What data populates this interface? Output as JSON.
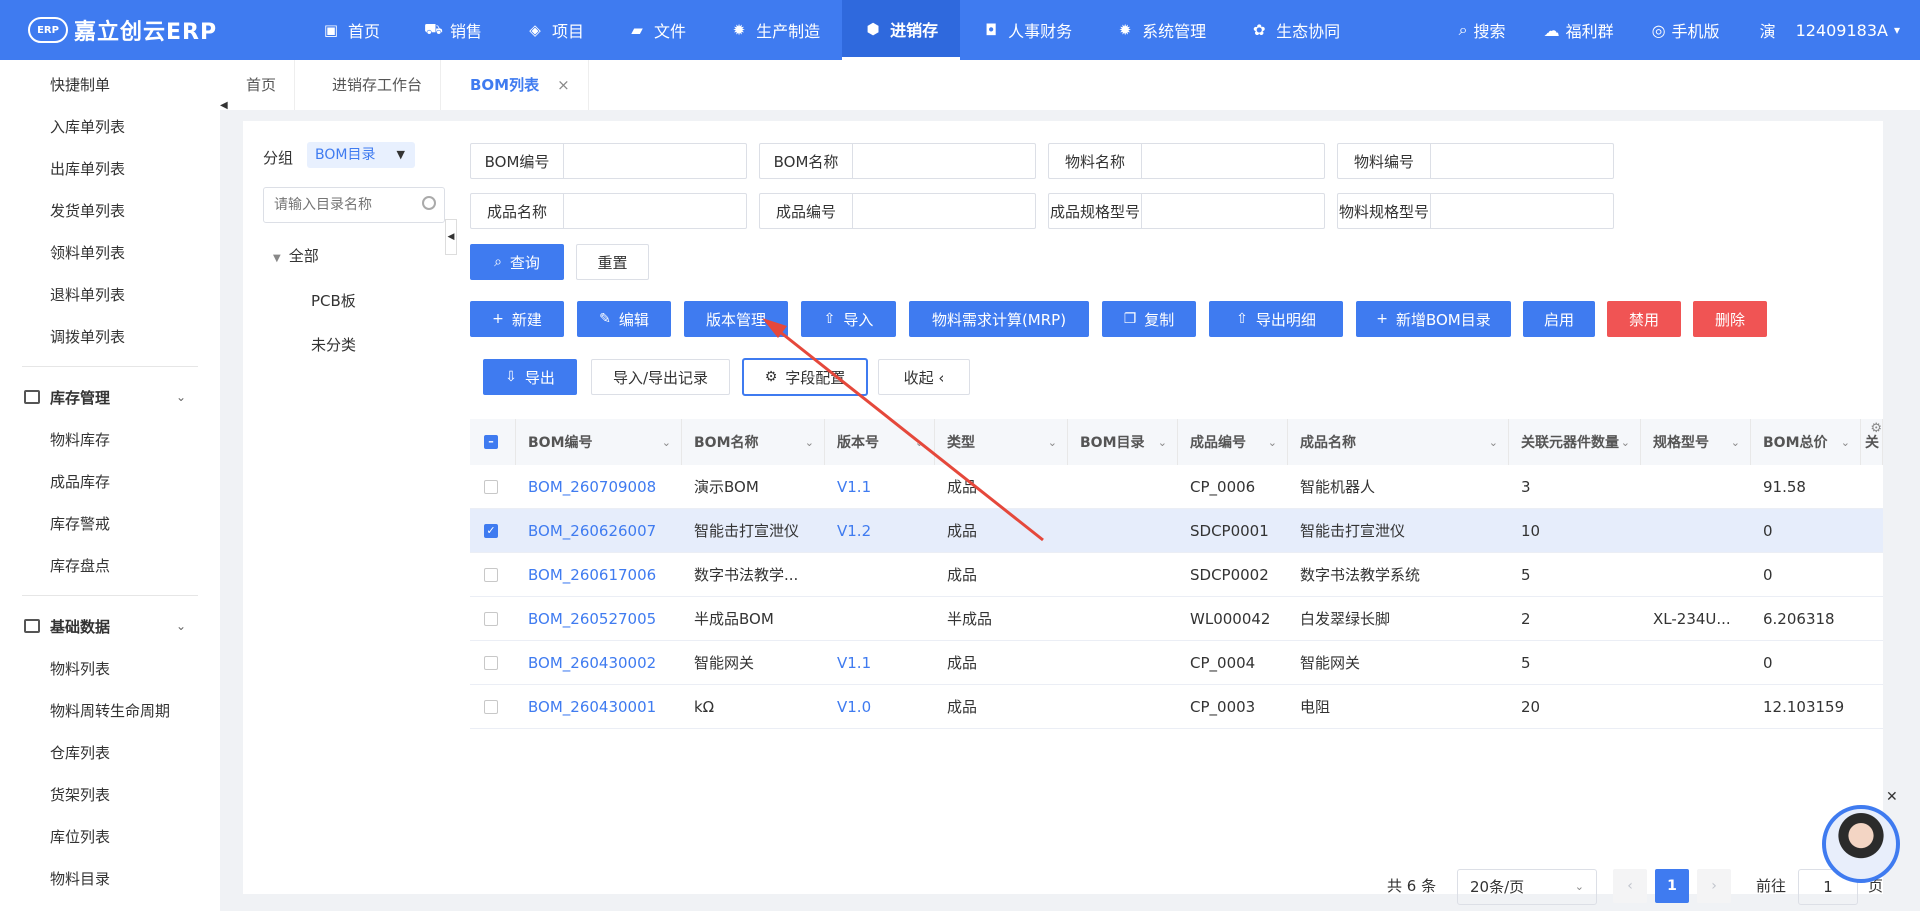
{
  "app": {
    "logo_mark": "ERP",
    "logo_text": "嘉立创云ERP"
  },
  "nav": {
    "items": [
      {
        "label": "首页",
        "icon": "monitor-icon",
        "glyph": "▣"
      },
      {
        "label": "销售",
        "icon": "cart-icon",
        "glyph": "⛟"
      },
      {
        "label": "项目",
        "icon": "layers-icon",
        "glyph": "◈"
      },
      {
        "label": "文件",
        "icon": "folder-icon",
        "glyph": "▰"
      },
      {
        "label": "生产制造",
        "icon": "gear-icon",
        "glyph": "✹"
      },
      {
        "label": "进销存",
        "icon": "cube-icon",
        "glyph": "⬢"
      },
      {
        "label": "人事财务",
        "icon": "finance-icon",
        "glyph": "◘"
      },
      {
        "label": "系统管理",
        "icon": "settings-icon",
        "glyph": "✹"
      },
      {
        "label": "生态协同",
        "icon": "ecosystem-icon",
        "glyph": "✿"
      }
    ],
    "active_index": 5,
    "right": [
      {
        "label": "搜索",
        "icon": "search-icon",
        "glyph": "⌕"
      },
      {
        "label": "福利群",
        "icon": "wechat-icon",
        "glyph": "☁"
      },
      {
        "label": "手机版",
        "icon": "phone-icon",
        "glyph": "◎"
      }
    ],
    "user_initial": "演",
    "user_id": "12409183A",
    "user_caret": "▾"
  },
  "sidebar": {
    "top_links": [
      "快捷制单",
      "入库单列表",
      "出库单列表",
      "发货单列表",
      "领料单列表",
      "退料单列表",
      "调拨单列表"
    ],
    "groups": [
      {
        "title": "库存管理",
        "links": [
          "物料库存",
          "成品库存",
          "库存警戒",
          "库存盘点"
        ]
      },
      {
        "title": "基础数据",
        "links": [
          "物料列表",
          "物料周转生命周期",
          "仓库列表",
          "货架列表",
          "库位列表",
          "物料目录"
        ]
      }
    ]
  },
  "tabs": [
    {
      "label": "首页"
    },
    {
      "label": "进销存工作台"
    },
    {
      "label": "BOM列表",
      "close": "×"
    }
  ],
  "group_panel": {
    "label": "分组",
    "select_value": "BOM目录",
    "search_placeholder": "请输入目录名称",
    "tree_root": "全部",
    "tree_children": [
      "PCB板",
      "未分类"
    ]
  },
  "filters": {
    "row1": [
      "BOM编号",
      "BOM名称",
      "物料名称",
      "物料编号"
    ],
    "row2": [
      "成品名称",
      "成品编号",
      "成品规格型号",
      "物料规格型号"
    ],
    "query": "查询",
    "reset": "重置"
  },
  "toolbar": {
    "row1": [
      {
        "label": "新建",
        "icon": "plus-icon",
        "glyph": "+",
        "style": "primary"
      },
      {
        "label": "编辑",
        "icon": "edit-icon",
        "glyph": "✎",
        "style": "primary"
      },
      {
        "label": "版本管理",
        "icon": "",
        "glyph": "",
        "style": "primary"
      },
      {
        "label": "导入",
        "icon": "upload-icon",
        "glyph": "⇧",
        "style": "primary"
      },
      {
        "label": "物料需求计算(MRP)",
        "icon": "",
        "glyph": "",
        "style": "primary"
      },
      {
        "label": "复制",
        "icon": "copy-icon",
        "glyph": "❐",
        "style": "primary"
      },
      {
        "label": "导出明细",
        "icon": "upload-icon",
        "glyph": "⇧",
        "style": "primary"
      },
      {
        "label": "新增BOM目录",
        "icon": "plus-icon",
        "glyph": "+",
        "style": "primary"
      },
      {
        "label": "启用",
        "icon": "",
        "glyph": "",
        "style": "primary"
      },
      {
        "label": "禁用",
        "icon": "",
        "glyph": "",
        "style": "danger"
      },
      {
        "label": "删除",
        "icon": "",
        "glyph": "",
        "style": "danger"
      }
    ],
    "row2": [
      {
        "label": "导出",
        "icon": "download-icon",
        "glyph": "⇩",
        "style": "primary"
      },
      {
        "label": "导入/导出记录",
        "icon": "",
        "glyph": "",
        "style": "default"
      },
      {
        "label": "字段配置",
        "icon": "gear-icon",
        "glyph": "⚙",
        "style": "default"
      },
      {
        "label": "收起 ‹",
        "icon": "",
        "glyph": "",
        "style": "default"
      }
    ]
  },
  "table": {
    "columns": [
      "BOM编号",
      "BOM名称",
      "版本号",
      "类型",
      "BOM目录",
      "成品编号",
      "成品名称",
      "关联元器件数量",
      "规格型号",
      "BOM总价",
      "关"
    ],
    "sort_glyph": "⌄",
    "rows": [
      {
        "bom_no": "BOM_260709008",
        "name": "演示BOM",
        "version": "V1.1",
        "type": "成品",
        "dir": "",
        "product_no": "CP_0006",
        "product_name": "智能机器人",
        "qty": "3",
        "spec": "",
        "price": "91.58",
        "checked": false
      },
      {
        "bom_no": "BOM_260626007",
        "name": "智能击打宣泄仪",
        "version": "V1.2",
        "type": "成品",
        "dir": "",
        "product_no": "SDCP0001",
        "product_name": "智能击打宣泄仪",
        "qty": "10",
        "spec": "",
        "price": "0",
        "checked": true
      },
      {
        "bom_no": "BOM_260617006",
        "name": "数字书法教学...",
        "version": "",
        "type": "成品",
        "dir": "",
        "product_no": "SDCP0002",
        "product_name": "数字书法教学系统",
        "qty": "5",
        "spec": "",
        "price": "0",
        "checked": false
      },
      {
        "bom_no": "BOM_260527005",
        "name": "半成品BOM",
        "version": "",
        "type": "半成品",
        "dir": "",
        "product_no": "WL000042",
        "product_name": "白发翠绿长脚",
        "qty": "2",
        "spec": "XL-234U...",
        "price": "6.206318",
        "checked": false
      },
      {
        "bom_no": "BOM_260430002",
        "name": "智能网关",
        "version": "V1.1",
        "type": "成品",
        "dir": "",
        "product_no": "CP_0004",
        "product_name": "智能网关",
        "qty": "5",
        "spec": "",
        "price": "0",
        "checked": false
      },
      {
        "bom_no": "BOM_260430001",
        "name": "kΩ",
        "version": "V1.0",
        "type": "成品",
        "dir": "",
        "product_no": "CP_0003",
        "product_name": "电阻",
        "qty": "20",
        "spec": "",
        "price": "12.103159",
        "checked": false
      }
    ]
  },
  "pagination": {
    "total": "共 6 条",
    "page_size": "20条/页",
    "prev": "‹",
    "next": "›",
    "current": "1",
    "goto_label": "前往",
    "goto_value": "1",
    "page_suffix": "页"
  },
  "colors": {
    "primary": "#3f7bf0",
    "danger": "#f05454",
    "annotation_arrow": "#e5483b"
  }
}
